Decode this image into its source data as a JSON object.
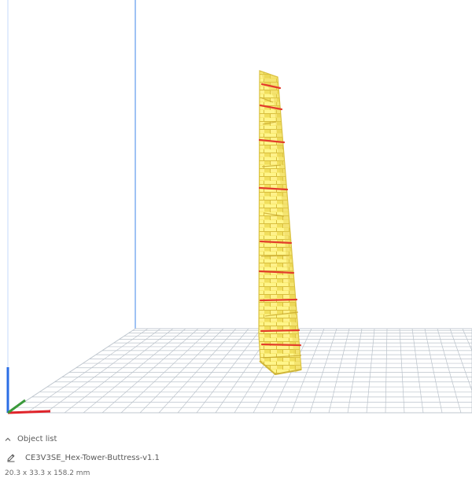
{
  "object_list": {
    "label": "Object list",
    "expanded": false
  },
  "object": {
    "name": "CE3V3SE_Hex-Tower-Buttress-v1.1",
    "dimensions": "20.3 x 33.3 x 158.2 mm"
  },
  "icons": {
    "toggle": "chevron-up-icon",
    "edit": "pencil-icon"
  },
  "colors": {
    "grid_lines": "#b7bfc8",
    "build_plate": "#ffffff",
    "axis_x": "#e0242a",
    "axis_y": "#3b9a3b",
    "axis_z": "#2b6ee6",
    "model_fill": "#f8ea70",
    "model_shadow": "#ead352",
    "model_accent": "#e33d2c",
    "volume_edge": "#3f84ea"
  }
}
